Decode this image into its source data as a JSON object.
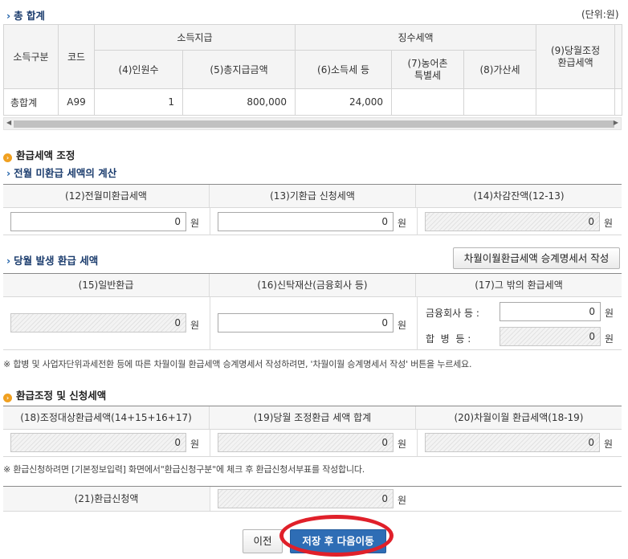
{
  "summary": {
    "title": "총 합계",
    "unit_label": "(단위:원)",
    "headers": {
      "income_type": "소득구분",
      "code": "코드",
      "income_paid": "소득지급",
      "tax_withheld": "징수세액",
      "col4": "(4)인원수",
      "col5": "(5)총지급금액",
      "col6": "(6)소득세 등",
      "col7": "(7)농어촌\n특별세",
      "col8": "(8)가산세",
      "col9": "(9)당월조정\n환급세액"
    },
    "row": {
      "income_type": "총합계",
      "code": "A99",
      "count": "1",
      "total_paid": "800,000",
      "income_tax": "24,000",
      "rural_tax": "",
      "penalty": "",
      "refund_adjust": ""
    }
  },
  "refund_adjust": {
    "title": "환급세액 조정",
    "prev_month": {
      "title": "전월 미환급 세액의 계산",
      "headers": [
        "(12)전월미환급세액",
        "(13)기환급 신청세액",
        "(14)차감잔액(12-13)"
      ],
      "values": [
        "0",
        "0",
        "0"
      ]
    },
    "current_month": {
      "title": "당월 발생 환급 세액",
      "button": "차월이월환급세액 승계명세서 작성",
      "headers": [
        "(15)일반환급",
        "(16)신탁재산(금융회사 등)",
        "(17)그 밖의 환급세액"
      ],
      "general_refund": "0",
      "trust_property": "0",
      "financial_label": "금융회사 등 :",
      "financial_value": "0",
      "merger_label": "합  병  등 :",
      "merger_value": "0"
    },
    "note": "※ 합병 및 사업자단위과세전환 등에 따른 차월이월 환급세액 승계명세서 작성하려면, '차월이월 승계명세서 작성' 버튼을 누르세요."
  },
  "refund_request": {
    "title": "환급조정 및 신청세액",
    "headers": [
      "(18)조정대상환급세액(14+15+16+17)",
      "(19)당월 조정환급 세액 합계",
      "(20)차월이월 환급세액(18-19)"
    ],
    "values": [
      "0",
      "0",
      "0"
    ],
    "note": "※ 환급신청하려면 [기본정보입력] 화면에서\"환급신청구분\"에 체크 후 환급신청서부표를 작성합니다.",
    "apply_label": "(21)환급신청액",
    "apply_value": "0"
  },
  "won": "원",
  "buttons": {
    "prev": "이전",
    "save_next": "저장 후 다음이동"
  },
  "colors": {
    "accent": "#2e6db5",
    "highlight": "#e0202a",
    "section_icon": "#f0a020"
  }
}
